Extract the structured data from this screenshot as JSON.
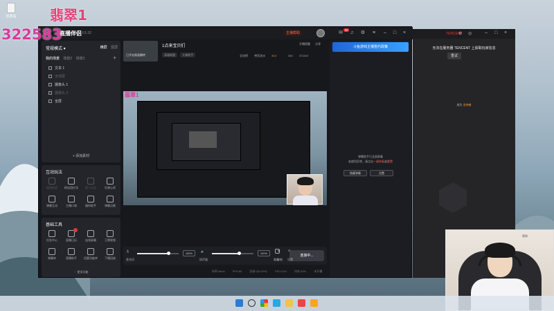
{
  "desktop": {
    "icon_label": "回收站",
    "overlay_title": "翡翠1",
    "overlay_number": "322583"
  },
  "app": {
    "logo": "直播伴侣",
    "version": "6.5.32",
    "live_notice": "主播帮助",
    "sidebar": {
      "mode": "常规模式",
      "mode_tabs": [
        "横屏",
        "竖屏"
      ],
      "scene_tabs": [
        "我的场景",
        "场景2",
        "场景3"
      ],
      "sources": [
        {
          "label": "文本 1",
          "state": "normal"
        },
        {
          "label": "无线屏",
          "state": "dim"
        },
        {
          "label": "摄像头 1",
          "state": "normal"
        },
        {
          "label": "摄像头 2",
          "state": "dim"
        },
        {
          "label": "全屏",
          "state": "normal"
        }
      ],
      "add_material": "+ 添加素材"
    },
    "interact": {
      "title": "互动玩法",
      "tools": [
        "福袋抽奖",
        "粉丝团红包",
        "超人玩法",
        "礼物心愿",
        "弹幕互动",
        "主播口袋",
        "福利助手",
        "弹幕点歌"
      ]
    },
    "basic": {
      "title": "基础工具",
      "tools": [
        "任务中心",
        "直播日历",
        "连线屏幕",
        "王牌视频",
        "弹幕库",
        "直播助手",
        "话题功能库",
        "下播回放"
      ],
      "more": "··· 更多功能"
    },
    "stream": {
      "thumb_caption": "已开启画面翻转",
      "title": "1点来宝贝们",
      "tags": [
        "英雄联盟",
        "大神助手"
      ],
      "stats": {
        "label1": "全站榜",
        "label2": "带货流水",
        "value2": "414",
        "likes": "264",
        "viewers": "371104"
      },
      "header_right": [
        "开播提醒",
        "分享"
      ]
    },
    "right_panel": {
      "promo": "斗鱼游戏主播签约政策",
      "message_line1": "弹幕助手已全部屏蔽",
      "message_line2a": "若使用异常，请点击",
      "message_link": "一键修复",
      "message_line2b": "或",
      "message_link2": "重置",
      "btn_hide": "隐藏弹幕",
      "btn_settings": "设置"
    },
    "controls": {
      "mic_label": "麦克风",
      "mic_volume": "150%",
      "mic_level": 0.75,
      "speaker_label": "扬声器",
      "speaker_volume": "100%",
      "speaker_level": 0.65,
      "effects": "美颜",
      "record": "录制",
      "settings": "设置",
      "live_button": "连接中..."
    },
    "status": [
      "码率:0kb/s",
      "FPS:60",
      "丢帧:0(0.00%)",
      "CPU:11%",
      "内存:30%",
      "未开播"
    ]
  },
  "side_window": {
    "brand": "TENCENT",
    "message": "无法在服务器 TENCENT 上获取玩家信息",
    "retry": "重试",
    "support_prefix": "成为",
    "support_link": "支持者"
  },
  "webcam": {
    "label": "翡翠"
  }
}
